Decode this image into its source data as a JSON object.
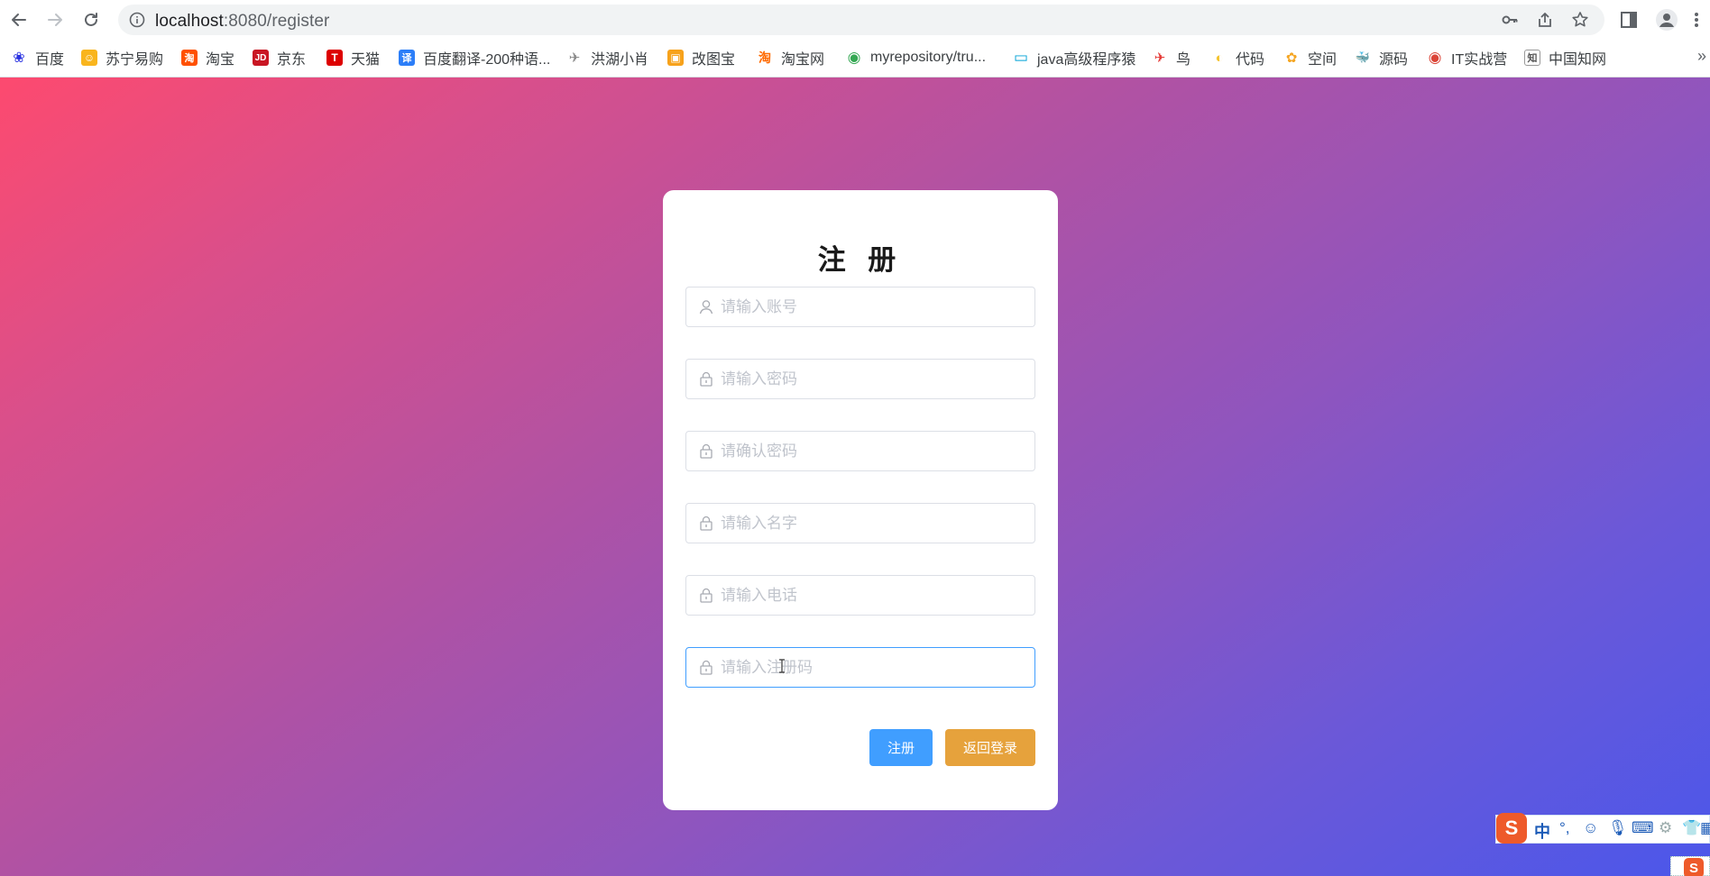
{
  "browser": {
    "url_host": "localhost",
    "url_rest": ":8080/register",
    "bookmarks": [
      {
        "label": "百度",
        "icon": "baidu-paw-icon",
        "color": "#2932e1",
        "glyph": "❀"
      },
      {
        "label": "苏宁易购",
        "icon": "suning-icon",
        "color": "#f9b51d",
        "glyph": "☺"
      },
      {
        "label": "淘宝",
        "icon": "taobao-icon",
        "color": "#ff5000",
        "glyph": "淘"
      },
      {
        "label": "京东",
        "icon": "jd-icon",
        "color": "#c91623",
        "glyph": "JD"
      },
      {
        "label": "天猫",
        "icon": "tmall-icon",
        "color": "#dd0000",
        "glyph": "T"
      },
      {
        "label": "百度翻译-200种语...",
        "icon": "baidu-translate-icon",
        "color": "#2c7ef8",
        "glyph": "译"
      },
      {
        "label": "洪湖小肖",
        "icon": "bird-icon",
        "color": "#888888",
        "glyph": "✈"
      },
      {
        "label": "改图宝",
        "icon": "gaitubao-icon",
        "color": "#f7a21b",
        "glyph": "▣"
      },
      {
        "label": "淘宝网",
        "icon": "taobao-icon",
        "color": "#ff6a00",
        "glyph": "淘"
      },
      {
        "label": "myrepository/tru...",
        "icon": "chrome-icon",
        "color": "#34a853",
        "glyph": "◉"
      },
      {
        "label": "java高级程序猿",
        "icon": "bilibili-icon",
        "color": "#00a1d6",
        "glyph": "▭"
      },
      {
        "label": "鸟",
        "icon": "bird-red-icon",
        "color": "#e53935",
        "glyph": "✈"
      },
      {
        "label": "代码",
        "icon": "code-icon",
        "color": "#f4c430",
        "glyph": "◐"
      },
      {
        "label": "空间",
        "icon": "qzone-icon",
        "color": "#f5a623",
        "glyph": "✿"
      },
      {
        "label": "源码",
        "icon": "docker-icon",
        "color": "#2496ed",
        "glyph": "🐳"
      },
      {
        "label": "IT实战营",
        "icon": "chrome-red-icon",
        "color": "#db4437",
        "glyph": "◉"
      },
      {
        "label": "中国知网",
        "icon": "cnki-icon",
        "color": "#555555",
        "glyph": "知"
      }
    ]
  },
  "form": {
    "title": "注 册",
    "fields": [
      {
        "placeholder": "请输入账号",
        "icon": "user-icon"
      },
      {
        "placeholder": "请输入密码",
        "icon": "lock-icon"
      },
      {
        "placeholder": "请确认密码",
        "icon": "lock-icon"
      },
      {
        "placeholder": "请输入名字",
        "icon": "lock-icon"
      },
      {
        "placeholder": "请输入电话",
        "icon": "lock-icon"
      },
      {
        "placeholder": "请输入注册码",
        "icon": "lock-icon"
      }
    ],
    "register_label": "注册",
    "back_label": "返回登录"
  },
  "ime": {
    "logo": "S",
    "mode": "中",
    "punct": "°,"
  },
  "colors": {
    "primary": "#409eff",
    "warning": "#e6a23c",
    "gradient_start": "#fd4a6f",
    "gradient_end": "#4b57ea"
  }
}
